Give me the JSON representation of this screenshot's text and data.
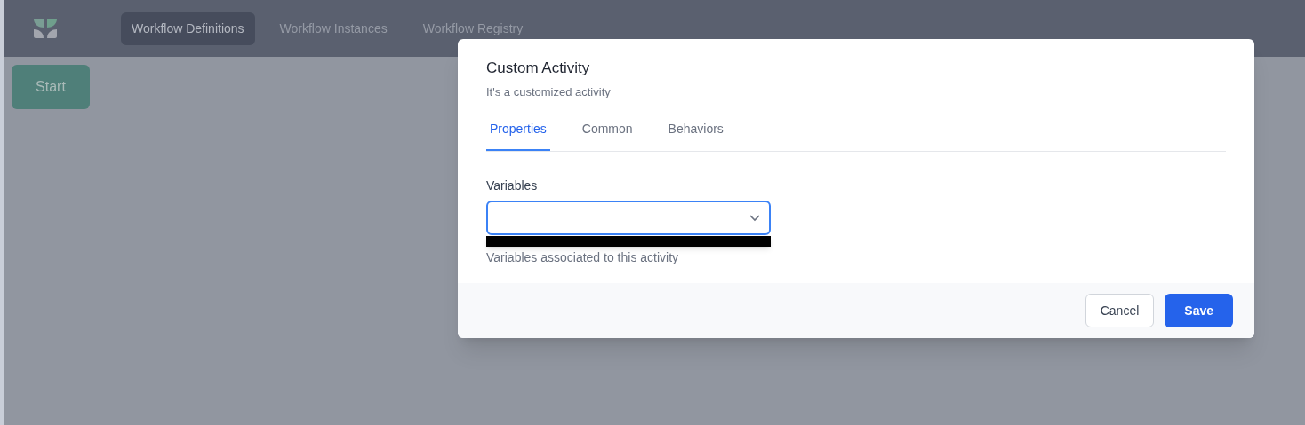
{
  "nav": {
    "items": [
      {
        "label": "Workflow Definitions",
        "selected": true
      },
      {
        "label": "Workflow Instances",
        "selected": false
      },
      {
        "label": "Workflow Registry",
        "selected": false
      }
    ]
  },
  "canvas": {
    "start_node": "Start"
  },
  "dialog": {
    "title": "Custom Activity",
    "subtitle": "It's a customized activity",
    "tabs": [
      {
        "label": "Properties",
        "selected": true
      },
      {
        "label": "Common",
        "selected": false
      },
      {
        "label": "Behaviors",
        "selected": false
      }
    ],
    "field": {
      "label": "Variables",
      "hint": "Variables associated to this activity",
      "redacted": true
    },
    "buttons": [
      {
        "label": "Cancel",
        "kind": "secondary"
      },
      {
        "label": "Save",
        "kind": "primary"
      }
    ]
  }
}
